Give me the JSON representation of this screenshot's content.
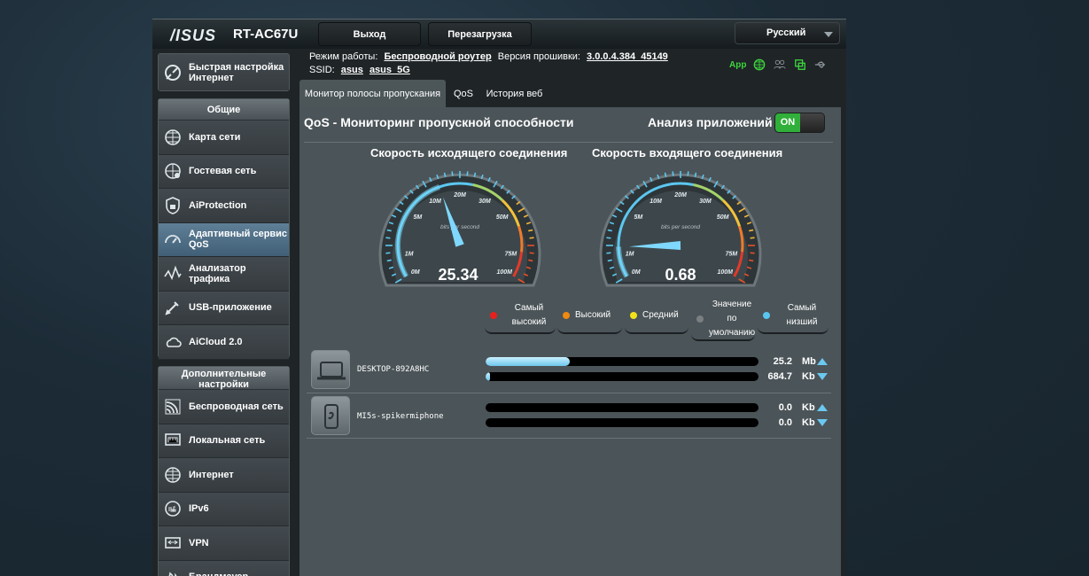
{
  "header": {
    "logo": "/ISUS",
    "model": "RT-AC67U",
    "logout": "Выход",
    "reboot": "Перезагрузка",
    "language": "Русский"
  },
  "info": {
    "mode_label": "Режим работы:",
    "mode_value": "Беспроводной роутер",
    "fw_label": "Версия прошивки:",
    "fw_value": "3.0.0.4.384_45149",
    "ssid_label": "SSID:",
    "ssid1": "asus",
    "ssid2": "asus_5G",
    "app_label": "App"
  },
  "sidebar": {
    "quick": "Быстрая настройка Интернет",
    "general_head": "Общие",
    "general": [
      {
        "label": "Карта сети",
        "icon": "network-map-icon"
      },
      {
        "label": "Гостевая сеть",
        "icon": "guest-network-icon"
      },
      {
        "label": "AiProtection",
        "icon": "aiprotection-icon"
      },
      {
        "label": "Адаптивный сервис QoS",
        "icon": "qos-icon"
      },
      {
        "label": "Анализатор трафика",
        "icon": "traffic-analyzer-icon"
      },
      {
        "label": "USB-приложение",
        "icon": "usb-icon"
      },
      {
        "label": "AiCloud 2.0",
        "icon": "cloud-icon"
      }
    ],
    "advanced_head": "Дополнительные настройки",
    "advanced": [
      {
        "label": "Беспроводная сеть",
        "icon": "wireless-icon"
      },
      {
        "label": "Локальная сеть",
        "icon": "lan-icon"
      },
      {
        "label": "Интернет",
        "icon": "globe-icon"
      },
      {
        "label": "IPv6",
        "icon": "ipv6-icon"
      },
      {
        "label": "VPN",
        "icon": "vpn-icon"
      },
      {
        "label": "Брандмауэр",
        "icon": "firewall-icon"
      }
    ]
  },
  "tabs": [
    "Монитор полосы пропускания",
    "QoS",
    "История веб"
  ],
  "main": {
    "title": "QoS - Мониторинг пропускной способности",
    "analyze_label": "Анализ приложений",
    "toggle": "ON",
    "upload_title": "Скорость исходящего соединения",
    "download_title": "Скорость входящего соединения",
    "gauge_unit": "bits per second",
    "gauge_ticks": [
      "0M",
      "1M",
      "5M",
      "10M",
      "20M",
      "30M",
      "50M",
      "75M",
      "100M"
    ],
    "upload_value": "25.34",
    "download_value": "0.68",
    "upload_fraction": 0.42,
    "download_fraction": 0.12
  },
  "legend": [
    {
      "label": "Самый высокий",
      "color": "#e8201c"
    },
    {
      "label": "Высокий",
      "color": "#f08a10"
    },
    {
      "label": "Средний",
      "color": "#f2e21b"
    },
    {
      "label": "Значение по умолчанию",
      "color": "#7a7f82"
    },
    {
      "label": "Самый низший",
      "color": "#58c6f0"
    }
  ],
  "devices": [
    {
      "name": "DESKTOP-892A8HC",
      "icon": "laptop-icon",
      "up_rate": "25.2",
      "up_unit": "Mb",
      "down_rate": "684.7",
      "down_unit": "Kb",
      "up_fill": 0.31,
      "down_fill": 0.015
    },
    {
      "name": "MI5s-spikermiphone",
      "icon": "phone-icon",
      "up_rate": "0.0",
      "up_unit": "Kb",
      "down_rate": "0.0",
      "down_unit": "Kb",
      "up_fill": 0,
      "down_fill": 0
    }
  ]
}
